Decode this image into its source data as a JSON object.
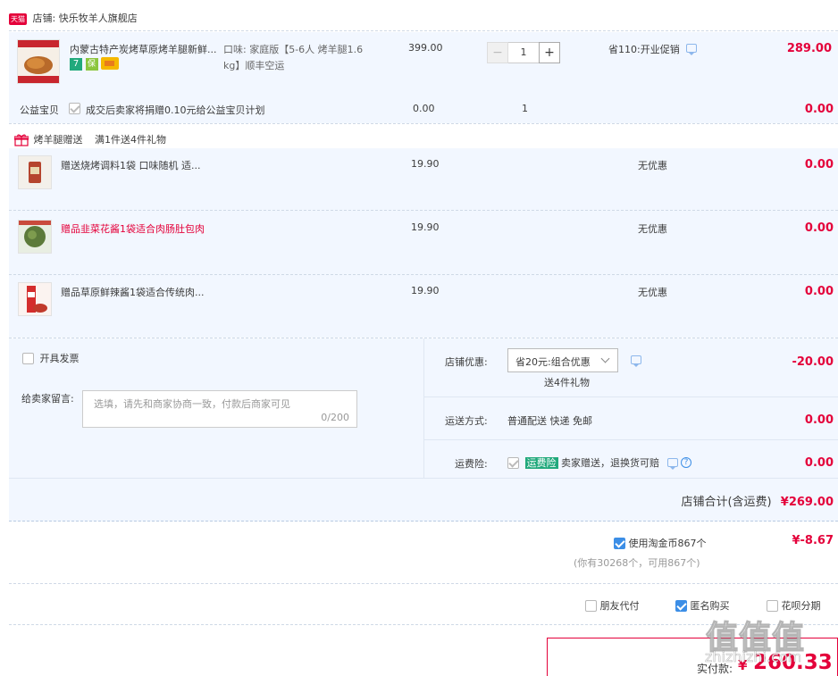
{
  "shop": {
    "badge": "天猫",
    "label": "店铺:",
    "name": "快乐牧羊人旗舰店"
  },
  "main_item": {
    "title": "内蒙古特产炭烤草原烤羊腿新鲜...",
    "spec_line1": "口味: 家庭版【5-6人 烤羊腿1.6",
    "spec_line2": "kg】顺丰空运",
    "price": "399.00",
    "qty": "1",
    "minus": "−",
    "plus": "+",
    "promo": "省110:开业促销",
    "subtotal": "289.00"
  },
  "charity": {
    "label": "公益宝贝",
    "text": "成交后卖家将捐赠0.10元给公益宝贝计划",
    "price": "0.00",
    "qty": "1",
    "subtotal": "0.00"
  },
  "gift_header": {
    "title": "烤羊腿赠送",
    "rule": "满1件送4件礼物"
  },
  "gifts": [
    {
      "title": "赠送烧烤调料1袋 口味随机 适...",
      "price": "19.90",
      "promo": "无优惠",
      "subtotal": "0.00",
      "highlight": false
    },
    {
      "title": "赠品韭菜花酱1袋适合肉肠肚包肉",
      "price": "19.90",
      "promo": "无优惠",
      "subtotal": "0.00",
      "highlight": true
    },
    {
      "title": "赠品草原鲜辣酱1袋适合传统肉...",
      "price": "19.90",
      "promo": "无优惠",
      "subtotal": "0.00",
      "highlight": false
    }
  ],
  "invoice": {
    "label": "开具发票"
  },
  "message": {
    "label": "给卖家留言:",
    "placeholder": "选填，请先和商家协商一致，付款后商家可见",
    "counter": "0/200"
  },
  "shop_discount": {
    "label": "店铺优惠:",
    "select": "省20元:组合优惠",
    "sub": "送4件礼物",
    "amount": "-20.00"
  },
  "shipping": {
    "label": "运送方式:",
    "value": "普通配送 快递 免邮",
    "amount": "0.00"
  },
  "insurance": {
    "label": "运费险:",
    "badge": "运费险",
    "text": "卖家赠送，退换货可赔",
    "amount": "0.00"
  },
  "shop_total": {
    "label": "店铺合计(含运费)",
    "amount": "¥269.00"
  },
  "coins": {
    "label": "使用淘金币867个",
    "detail": "(你有30268个，可用867个)",
    "amount": "¥-8.67"
  },
  "options": {
    "friend_pay": "朋友代付",
    "anonymous": "匿名购买",
    "huabei": "花呗分期"
  },
  "pay": {
    "label": "实付款:",
    "currency": "¥",
    "amount": "260.33"
  },
  "watermark": {
    "big": "值值值",
    "small": "zhizhizhi.com"
  },
  "colors": {
    "accent": "#e4003a",
    "blue": "#3c8ee6",
    "panel": "#f2f7ff"
  }
}
